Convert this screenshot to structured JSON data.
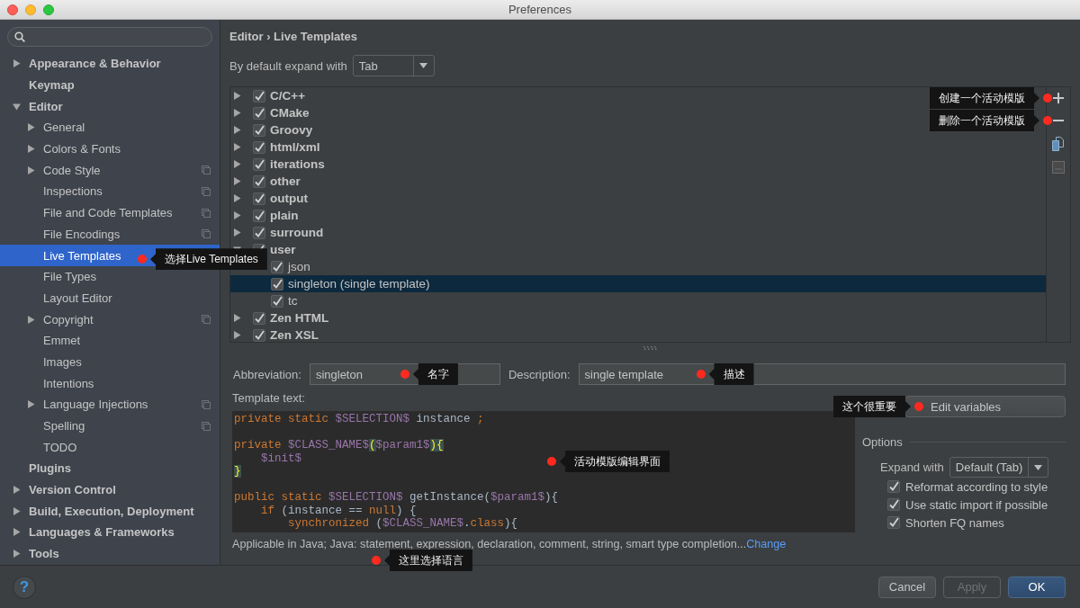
{
  "window": {
    "title": "Preferences"
  },
  "sidebar": {
    "items": [
      {
        "label": "Appearance & Behavior",
        "expanded": false,
        "scoped": false,
        "selected": false
      },
      {
        "label": "Keymap",
        "scoped": false,
        "selected": false
      },
      {
        "label": "Editor",
        "expanded": true,
        "scoped": false,
        "selected": false,
        "children": [
          {
            "label": "General",
            "expanded": false,
            "scoped": false,
            "selected": false
          },
          {
            "label": "Colors & Fonts",
            "expanded": false,
            "scoped": false,
            "selected": false
          },
          {
            "label": "Code Style",
            "expanded": false,
            "scoped": true,
            "selected": false
          },
          {
            "label": "Inspections",
            "scoped": true,
            "selected": false
          },
          {
            "label": "File and Code Templates",
            "scoped": true,
            "selected": false
          },
          {
            "label": "File Encodings",
            "scoped": true,
            "selected": false
          },
          {
            "label": "Live Templates",
            "scoped": false,
            "selected": true,
            "annotation": "选择Live Templates"
          },
          {
            "label": "File Types",
            "scoped": false,
            "selected": false
          },
          {
            "label": "Layout Editor",
            "scoped": false,
            "selected": false
          },
          {
            "label": "Copyright",
            "expanded": false,
            "scoped": true,
            "selected": false
          },
          {
            "label": "Emmet",
            "scoped": false,
            "selected": false
          },
          {
            "label": "Images",
            "scoped": false,
            "selected": false
          },
          {
            "label": "Intentions",
            "scoped": false,
            "selected": false
          },
          {
            "label": "Language Injections",
            "expanded": false,
            "scoped": true,
            "selected": false
          },
          {
            "label": "Spelling",
            "scoped": true,
            "selected": false
          },
          {
            "label": "TODO",
            "scoped": false,
            "selected": false
          }
        ]
      },
      {
        "label": "Plugins",
        "scoped": false,
        "selected": false
      },
      {
        "label": "Version Control",
        "expanded": false,
        "scoped": false,
        "selected": false
      },
      {
        "label": "Build, Execution, Deployment",
        "expanded": false,
        "scoped": false,
        "selected": false
      },
      {
        "label": "Languages & Frameworks",
        "expanded": false,
        "scoped": false,
        "selected": false
      },
      {
        "label": "Tools",
        "expanded": false,
        "scoped": false,
        "selected": false
      }
    ]
  },
  "breadcrumb": "Editor › Live Templates",
  "expand_default": {
    "label": "By default expand with",
    "value": "Tab"
  },
  "templates": [
    {
      "label": "C/C++",
      "checked": true,
      "expanded": false,
      "selected": false
    },
    {
      "label": "CMake",
      "checked": true,
      "expanded": false,
      "selected": false
    },
    {
      "label": "Groovy",
      "checked": true,
      "expanded": false,
      "selected": false
    },
    {
      "label": "html/xml",
      "checked": true,
      "expanded": false,
      "selected": false
    },
    {
      "label": "iterations",
      "checked": true,
      "expanded": false,
      "selected": false
    },
    {
      "label": "other",
      "checked": true,
      "expanded": false,
      "selected": false
    },
    {
      "label": "output",
      "checked": true,
      "expanded": false,
      "selected": false
    },
    {
      "label": "plain",
      "checked": true,
      "expanded": false,
      "selected": false
    },
    {
      "label": "surround",
      "checked": true,
      "expanded": false,
      "selected": false
    },
    {
      "label": "user",
      "checked": true,
      "expanded": true,
      "selected": false,
      "children": [
        {
          "label": "json",
          "checked": true,
          "selected": false
        },
        {
          "label": "singleton (single template)",
          "checked": true,
          "selected": true
        },
        {
          "label": "tc",
          "checked": true,
          "selected": false
        }
      ]
    },
    {
      "label": "Zen HTML",
      "checked": true,
      "expanded": false,
      "selected": false
    },
    {
      "label": "Zen XSL",
      "checked": true,
      "expanded": false,
      "selected": false
    }
  ],
  "toolbar": [
    {
      "kind": "add",
      "disabled": false,
      "annotation": "创建一个活动模版"
    },
    {
      "kind": "remove",
      "disabled": false,
      "annotation": "删除一个活动模版"
    },
    {
      "kind": "copy",
      "disabled": false
    },
    {
      "kind": "restore",
      "disabled": true
    }
  ],
  "abbreviation": {
    "label": "Abbreviation:",
    "value": "singleton",
    "annotation": "名字"
  },
  "description": {
    "label": "Description:",
    "value": "single template",
    "annotation": "描述"
  },
  "template_text": {
    "label": "Template text:",
    "annotation": "活动模版编辑界面",
    "lines": [
      {
        "gap_before": false,
        "tokens": [
          {
            "kind": "keyword",
            "text": "private static "
          },
          {
            "kind": "variable",
            "text": "$SELECTION$"
          },
          {
            "kind": "plain",
            "text": " instance "
          },
          {
            "kind": "keyword",
            "text": ";"
          }
        ]
      },
      {
        "gap_before": true,
        "tokens": [
          {
            "kind": "keyword",
            "text": "private "
          },
          {
            "kind": "variable",
            "text": "$CLASS_NAME$"
          },
          {
            "kind": "match",
            "text": "("
          },
          {
            "kind": "variable",
            "text": "$param1$"
          },
          {
            "kind": "match",
            "text": "){"
          }
        ]
      },
      {
        "gap_before": false,
        "tokens": [
          {
            "kind": "variable",
            "text": "    $init$"
          }
        ]
      },
      {
        "gap_before": false,
        "tokens": [
          {
            "kind": "match",
            "text": "}"
          }
        ]
      },
      {
        "gap_before": true,
        "tokens": [
          {
            "kind": "keyword",
            "text": "public static "
          },
          {
            "kind": "variable",
            "text": "$SELECTION$"
          },
          {
            "kind": "plain",
            "text": " getInstance("
          },
          {
            "kind": "variable",
            "text": "$param1$"
          },
          {
            "kind": "plain",
            "text": "){"
          }
        ]
      },
      {
        "gap_before": false,
        "tokens": [
          {
            "kind": "keyword",
            "text": "    if"
          },
          {
            "kind": "plain",
            "text": " (instance == "
          },
          {
            "kind": "keyword",
            "text": "null"
          },
          {
            "kind": "plain",
            "text": ") {"
          }
        ]
      },
      {
        "gap_before": false,
        "tokens": [
          {
            "kind": "keyword",
            "text": "        synchronized"
          },
          {
            "kind": "plain",
            "text": " ("
          },
          {
            "kind": "variable",
            "text": "$CLASS_NAME$"
          },
          {
            "kind": "plain",
            "text": "."
          },
          {
            "kind": "keyword",
            "text": "class"
          },
          {
            "kind": "plain",
            "text": "){"
          }
        ]
      }
    ]
  },
  "applicable": {
    "text": "Applicable in Java; Java: statement, expression, declaration, comment, string, smart type completion...",
    "link": "Change",
    "annotation": "这里选择语言"
  },
  "edit_variables": {
    "label": "Edit variables",
    "annotation": "这个很重要"
  },
  "options": {
    "title": "Options",
    "expand_with": {
      "label": "Expand with",
      "value": "Default (Tab)"
    },
    "checks": [
      {
        "label": "Reformat according to style",
        "checked": true
      },
      {
        "label": "Use static import if possible",
        "checked": true
      },
      {
        "label": "Shorten FQ names",
        "checked": true
      }
    ]
  },
  "help": "?",
  "buttons": [
    {
      "label": "Cancel",
      "kind": "normal"
    },
    {
      "label": "Apply",
      "kind": "disabled"
    },
    {
      "label": "OK",
      "kind": "default"
    }
  ]
}
